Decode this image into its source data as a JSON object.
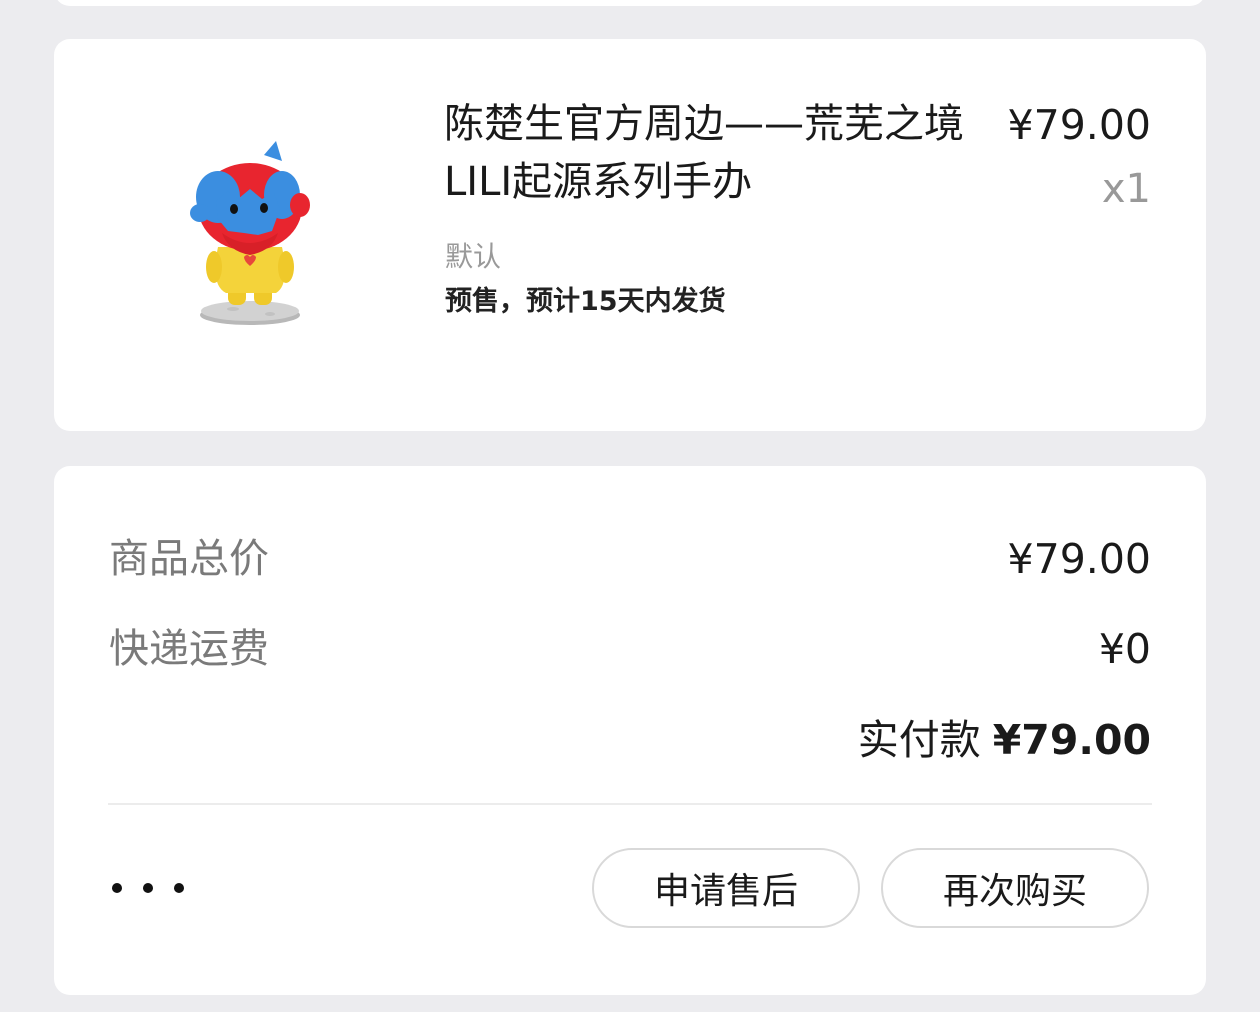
{
  "product": {
    "title": "陈楚生官方周边——荒芜之境LILI起源系列手办",
    "unit_price": "¥79.00",
    "quantity": "x1",
    "variant": "默认",
    "shipping_note": "预售，预计15天内发货"
  },
  "summary": {
    "goods_total_label": "商品总价",
    "goods_total_value": "¥79.00",
    "shipping_fee_label": "快递运费",
    "shipping_fee_value": "¥0",
    "paid_label": "实付款",
    "paid_value": "¥79.00"
  },
  "actions": {
    "more_icon": "more-dots-icon",
    "after_sale_label": "申请售后",
    "rebuy_label": "再次购买"
  },
  "colors": {
    "page_background": "#ececef",
    "card_background": "#ffffff",
    "muted_text": "#7a7a7a",
    "figure_hair": "#e8252f",
    "figure_face": "#3b8ee0",
    "figure_body": "#f4d33a"
  }
}
